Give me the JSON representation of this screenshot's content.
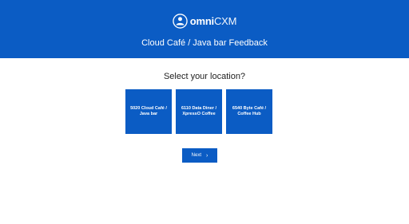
{
  "header": {
    "brand_bold": "omni",
    "brand_light": "CXM",
    "title": "Cloud Café / Java bar Feedback",
    "background": "#0b5cc4"
  },
  "main": {
    "prompt": "Select your location?",
    "locations": [
      {
        "label": "5020 Cloud Café / Java bar"
      },
      {
        "label": "6110 Data Diner / XpressO Coffee"
      },
      {
        "label": "6540 Byte Café / Coffee Hub"
      }
    ],
    "next_label": "Next",
    "next_icon": "chevron-right-icon"
  }
}
